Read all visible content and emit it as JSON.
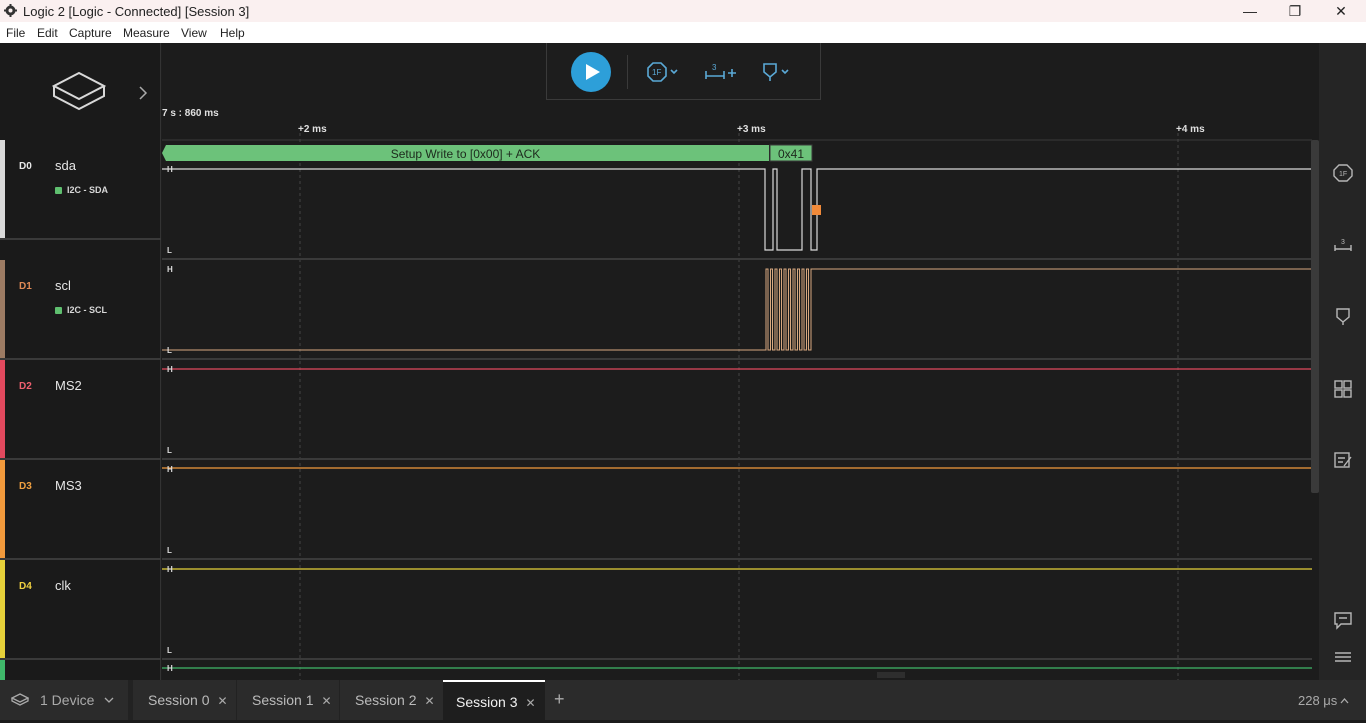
{
  "window": {
    "title": "Logic 2 [Logic - Connected] [Session 3]",
    "minimize": "—",
    "maximize": "❐",
    "close": "✕"
  },
  "menu": [
    "File",
    "Edit",
    "Capture",
    "Measure",
    "View",
    "Help"
  ],
  "timeline": {
    "offset_label": "7 s : 860 ms",
    "markers": [
      "+2 ms",
      "+3 ms",
      "+4 ms"
    ]
  },
  "channels": [
    {
      "id": "D0",
      "name": "sda",
      "analyzer": "I2C - SDA",
      "color": "#d9d9d9",
      "id_color": "#e8e8e8"
    },
    {
      "id": "D1",
      "name": "scl",
      "analyzer": "I2C - SCL",
      "color": "#9c7b63",
      "id_color": "#e08a55"
    },
    {
      "id": "D2",
      "name": "MS2",
      "analyzer": "",
      "color": "#e2495e",
      "id_color": "#f06070"
    },
    {
      "id": "D3",
      "name": "MS3",
      "analyzer": "",
      "color": "#f29a3c",
      "id_color": "#f0a040"
    },
    {
      "id": "D4",
      "name": "clk",
      "analyzer": "",
      "color": "#e6d13a",
      "id_color": "#f0d040"
    }
  ],
  "level_labels": {
    "high": "H",
    "low": "L"
  },
  "decode": {
    "setup": "Setup Write to [0x00] + ACK",
    "data": "0x41"
  },
  "bottom": {
    "device_label": "1 Device",
    "tabs": [
      {
        "label": "Session 0",
        "active": false
      },
      {
        "label": "Session 1",
        "active": false
      },
      {
        "label": "Session 2",
        "active": false
      },
      {
        "label": "Session 3",
        "active": true
      }
    ],
    "add_tab": "+",
    "zoom_label": "228 μs"
  },
  "colors": {
    "accent": "#2d9fd9",
    "decode_bar": "#6cc27a",
    "cursor_marker": "#f08a3a"
  }
}
